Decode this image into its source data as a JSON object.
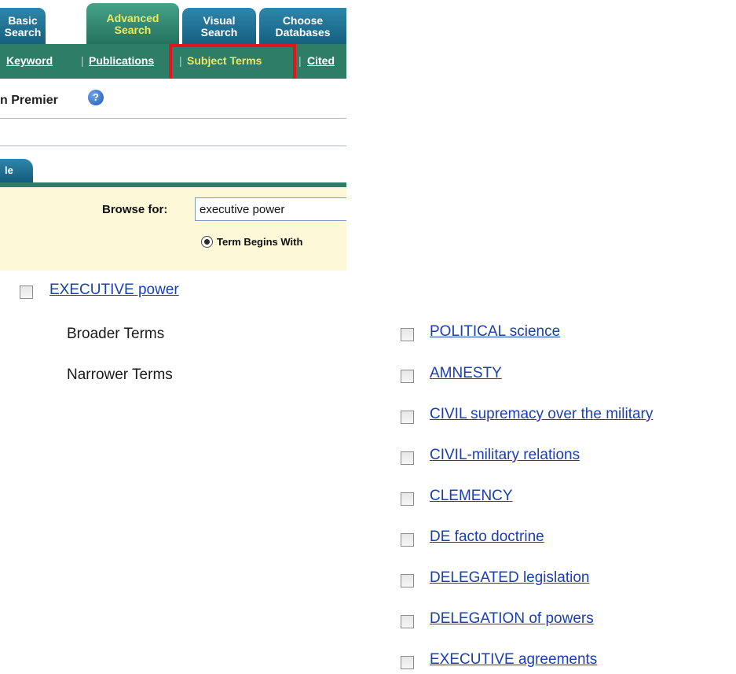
{
  "tabs": {
    "basic": "Basic\nSearch",
    "advanced": "Advanced\nSearch",
    "visual": "Visual\nSearch",
    "choose": "Choose\nDatabases"
  },
  "subnav": {
    "keyword": "Keyword",
    "publications": "Publications",
    "subject_terms": "Subject Terms",
    "cited": "Cited"
  },
  "database_name": "n Premier",
  "help_icon_glyph": "?",
  "subtab_label": "le",
  "search": {
    "browse_label": "Browse for:",
    "browse_value": "executive power",
    "radio_label": "Term Begins With"
  },
  "results": {
    "main_term": "EXECUTIVE power",
    "broader_label": "Broader Terms",
    "narrower_label": "Narrower Terms",
    "broader_terms": [
      "POLITICAL science"
    ],
    "narrower_terms": [
      "AMNESTY",
      "CIVIL supremacy over the military",
      "CIVIL-military relations",
      "CLEMENCY",
      "DE facto doctrine",
      "DELEGATED legislation",
      "DELEGATION of powers",
      "EXECUTIVE agreements"
    ]
  },
  "colors": {
    "tab_blue": "#1f6f93",
    "tab_green": "#2e7d67",
    "active_text": "#f0e75a",
    "highlight_red": "#e4141a",
    "link_blue": "#1a3fb0",
    "panel_bg": "#fcf8d8"
  }
}
